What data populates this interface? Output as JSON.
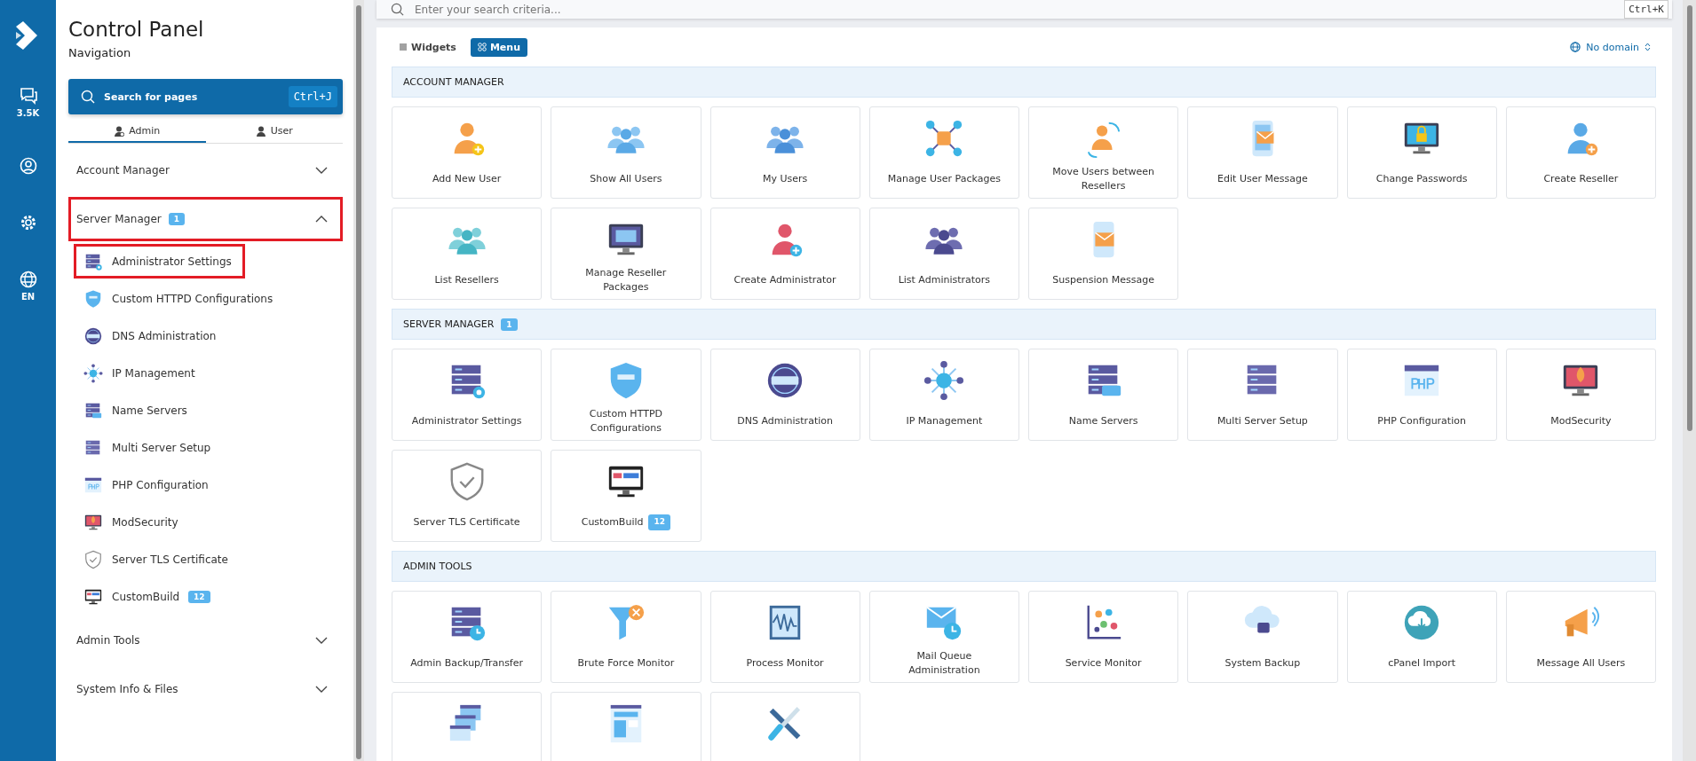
{
  "rail": {
    "chat_count": "3.5K",
    "language": "EN"
  },
  "sidebar": {
    "title": "Control Panel",
    "subtitle": "Navigation",
    "search": {
      "label": "Search for pages",
      "shortcut": "Ctrl+J"
    },
    "tabs": [
      {
        "label": "Admin",
        "selected": true
      },
      {
        "label": "User",
        "selected": false
      }
    ],
    "groups": [
      {
        "label": "Account Manager",
        "expanded": false,
        "highlighted": false
      },
      {
        "label": "Server Manager",
        "badge": "1",
        "expanded": true,
        "highlighted": true,
        "items": [
          {
            "label": "Administrator Settings",
            "highlighted": true
          },
          {
            "label": "Custom HTTPD Configurations",
            "highlighted": false
          },
          {
            "label": "DNS Administration",
            "highlighted": false
          },
          {
            "label": "IP Management",
            "highlighted": false
          },
          {
            "label": "Name Servers",
            "highlighted": false
          },
          {
            "label": "Multi Server Setup",
            "highlighted": false
          },
          {
            "label": "PHP Configuration",
            "highlighted": false
          },
          {
            "label": "ModSecurity",
            "highlighted": false
          },
          {
            "label": "Server TLS Certificate",
            "highlighted": false
          },
          {
            "label": "CustomBuild",
            "badge": "12",
            "highlighted": false
          }
        ]
      },
      {
        "label": "Admin Tools",
        "expanded": false,
        "highlighted": false
      },
      {
        "label": "System Info & Files",
        "expanded": false,
        "highlighted": false
      }
    ]
  },
  "main": {
    "search": {
      "placeholder": "Enter your search criteria...",
      "shortcut": "Ctrl+K"
    },
    "view_tabs": [
      {
        "label": "Widgets",
        "selected": false
      },
      {
        "label": "Menu",
        "selected": true
      }
    ],
    "domain": "No domain",
    "sections": [
      {
        "title": "ACCOUNT MANAGER",
        "tiles": [
          {
            "kind": "labeled",
            "label": "Add New User"
          },
          {
            "kind": "labeled",
            "label": "Show All Users"
          },
          {
            "kind": "labeled",
            "label": "My Users"
          },
          {
            "kind": "labeled",
            "label": "Manage User Packages"
          },
          {
            "kind": "labeled",
            "label": "Move Users between Resellers"
          },
          {
            "kind": "labeled",
            "label": "Edit User Message"
          },
          {
            "kind": "labeled",
            "label": "Change Passwords"
          },
          {
            "kind": "labeled",
            "label": "Create Reseller"
          },
          {
            "kind": "labeled",
            "label": "List Resellers"
          },
          {
            "kind": "labeled",
            "label": "Manage Reseller Packages"
          },
          {
            "kind": "labeled",
            "label": "Create Administrator"
          },
          {
            "kind": "labeled",
            "label": "List Administrators"
          },
          {
            "kind": "labeled",
            "label": "Suspension Message"
          }
        ]
      },
      {
        "title": "SERVER MANAGER",
        "badge": "1",
        "tiles": [
          {
            "kind": "labeled",
            "label": "Administrator Settings"
          },
          {
            "kind": "labeled",
            "label": "Custom HTTPD Configurations"
          },
          {
            "kind": "labeled",
            "label": "DNS Administration"
          },
          {
            "kind": "labeled",
            "label": "IP Management"
          },
          {
            "kind": "labeled",
            "label": "Name Servers"
          },
          {
            "kind": "labeled",
            "label": "Multi Server Setup"
          },
          {
            "kind": "labeled",
            "label": "PHP Configuration"
          },
          {
            "kind": "labeled",
            "label": "ModSecurity"
          },
          {
            "kind": "labeled",
            "label": "Server TLS Certificate"
          },
          {
            "kind": "labeled",
            "label": "CustomBuild",
            "badge": "12"
          }
        ]
      },
      {
        "title": "ADMIN TOOLS",
        "tiles": [
          {
            "kind": "labeled",
            "label": "Admin Backup/Transfer"
          },
          {
            "kind": "labeled",
            "label": "Brute Force Monitor"
          },
          {
            "kind": "labeled",
            "label": "Process Monitor"
          },
          {
            "kind": "labeled",
            "label": "Mail Queue Administration"
          },
          {
            "kind": "labeled",
            "label": "Service Monitor"
          },
          {
            "kind": "labeled",
            "label": "System Backup"
          },
          {
            "kind": "labeled",
            "label": "cPanel Import"
          },
          {
            "kind": "labeled",
            "label": "Message All Users"
          },
          {
            "kind": "clipped"
          },
          {
            "kind": "clipped"
          },
          {
            "kind": "clipped"
          }
        ]
      }
    ]
  }
}
